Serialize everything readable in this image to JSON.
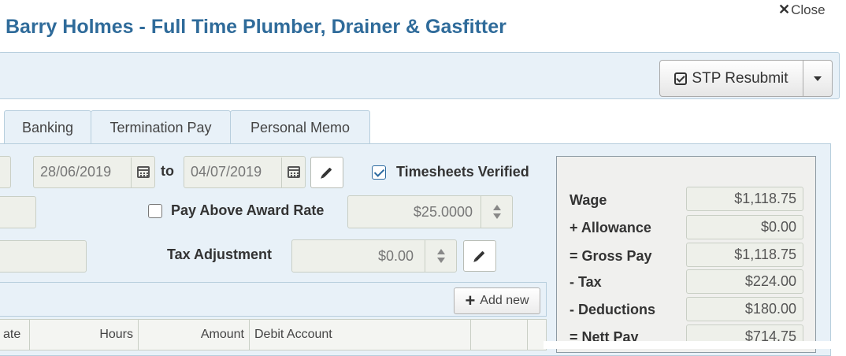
{
  "header": {
    "close_label": "Close",
    "title_name": "Barry Holmes",
    "title_separator": "-",
    "title_role": "Full Time Plumber, Drainer & Gasfitter"
  },
  "toolbar": {
    "stp_resubmit_label": "STP Resubmit"
  },
  "tabs": [
    {
      "label": "Banking"
    },
    {
      "label": "Termination Pay"
    },
    {
      "label": "Personal Memo"
    }
  ],
  "period": {
    "from_date": "28/06/2019",
    "to_label": "to",
    "to_date": "04/07/2019"
  },
  "timesheets_verified": {
    "label": "Timesheets Verified",
    "checked": true
  },
  "pay_above_award": {
    "label": "Pay Above Award Rate",
    "checked": false,
    "value": "$25.0000"
  },
  "tax_adjustment": {
    "label": "Tax Adjustment",
    "value": "$0.00"
  },
  "summary": {
    "rows": [
      {
        "label": "Wage",
        "value": "$1,118.75"
      },
      {
        "label": "+ Allowance",
        "value": "$0.00"
      },
      {
        "label": "= Gross Pay",
        "value": "$1,118.75"
      },
      {
        "label": "- Tax",
        "value": "$224.00"
      },
      {
        "label": "- Deductions",
        "value": "$180.00"
      },
      {
        "label": "= Nett Pay",
        "value": "$714.75"
      }
    ]
  },
  "grid": {
    "add_new_label": "Add new",
    "columns": [
      "ate",
      "Hours",
      "Amount",
      "Debit Account"
    ]
  },
  "colors": {
    "title": "#2f6b9a",
    "panel": "#e8f1f8",
    "border": "#b7cedd"
  }
}
